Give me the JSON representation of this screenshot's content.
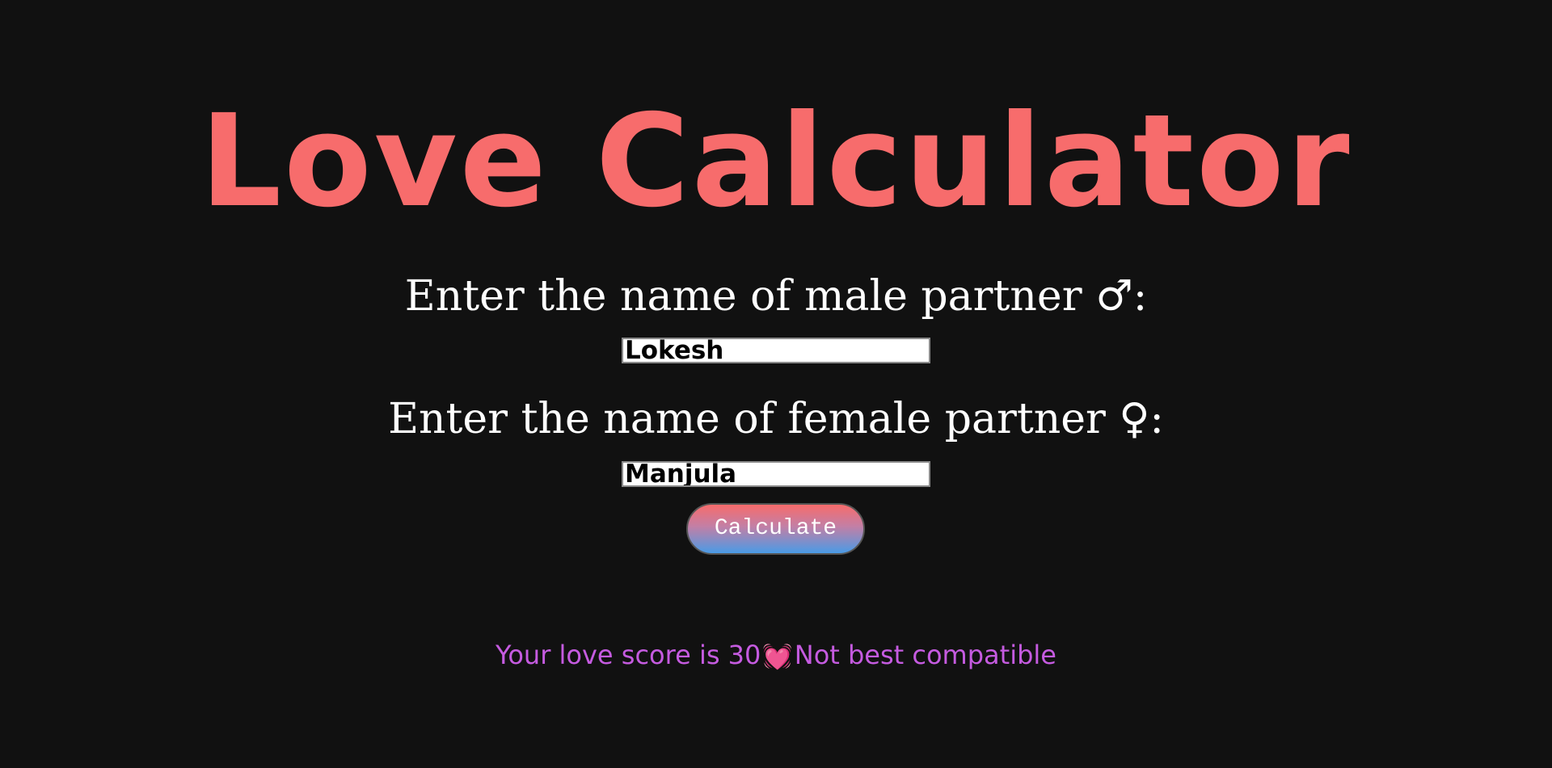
{
  "title": "Love Calculator",
  "male": {
    "label": "Enter the name of male partner ♂:",
    "value": "Lokesh"
  },
  "female": {
    "label": "Enter the name of female partner ♀:",
    "value": "Manjula"
  },
  "button": {
    "label": "Calculate"
  },
  "result": {
    "prefix": "Your love score is 30",
    "icon": "heart-icon",
    "suffix": "Not best compatible"
  },
  "colors": {
    "background": "#111111",
    "title": "#f76c6c",
    "result": "#c55be0",
    "heart": "#ff2f6d"
  }
}
